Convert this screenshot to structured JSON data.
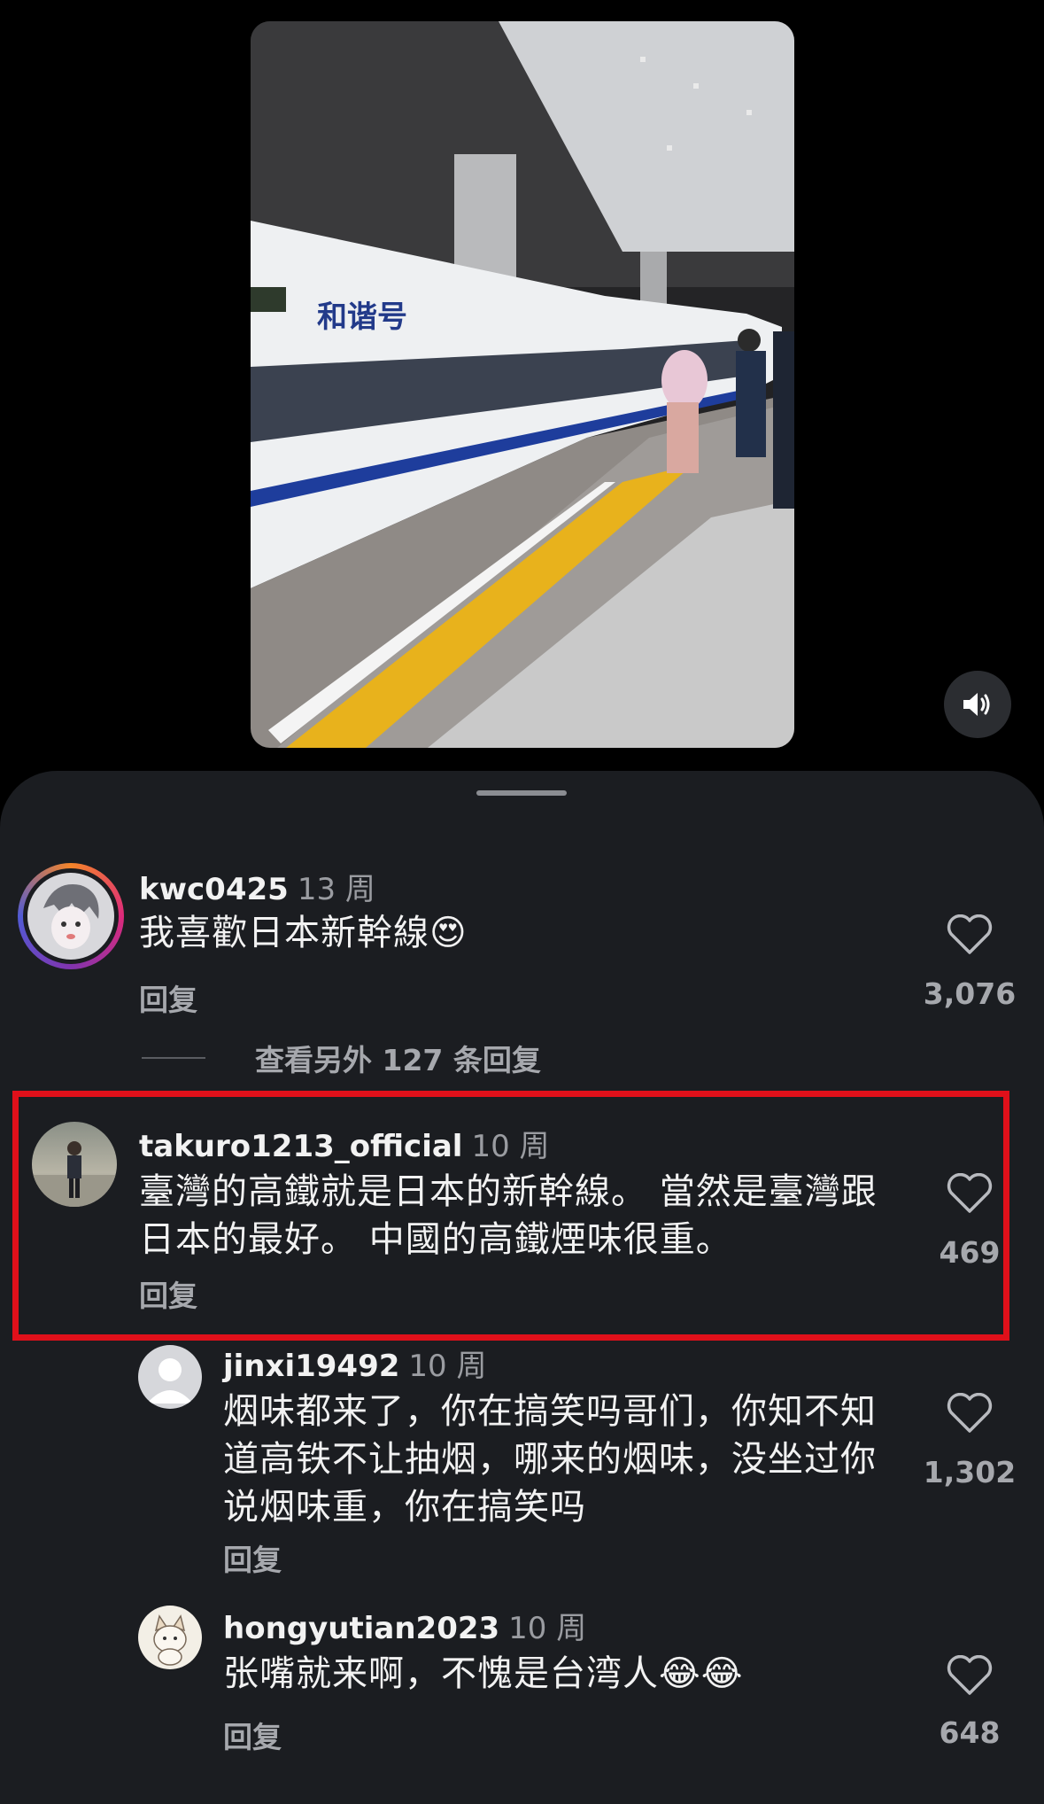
{
  "comments": [
    {
      "username": "kwc0425",
      "time": "13 周",
      "text": "我喜歡日本新幹線😍",
      "reply": "回复",
      "likes": "3,076",
      "view_more": "查看另外 127 条回复"
    },
    {
      "username": "takuro1213_official",
      "time": "10 周",
      "text": "臺灣的高鐵就是日本的新幹線。 當然是臺灣跟\n日本的最好。 中國的高鐵煙味很重。",
      "reply": "回复",
      "likes": "469"
    },
    {
      "username": "jinxi19492",
      "time": "10 周",
      "text": "烟味都来了，你在搞笑吗哥们，你知不知\n道高铁不让抽烟，哪来的烟味，没坐过你\n说烟味重，你在搞笑吗",
      "reply": "回复",
      "likes": "1,302"
    },
    {
      "username": "hongyutian2023",
      "time": "10 周",
      "text": "张嘴就来啊，不愧是台湾人😂😂",
      "reply": "回复",
      "likes": "648"
    }
  ],
  "video": {
    "train_name": "和谐号",
    "accent_blue": "#1e3d9c",
    "platform_yellow": "#e8b21c"
  },
  "highlight_color": "#e0101a"
}
